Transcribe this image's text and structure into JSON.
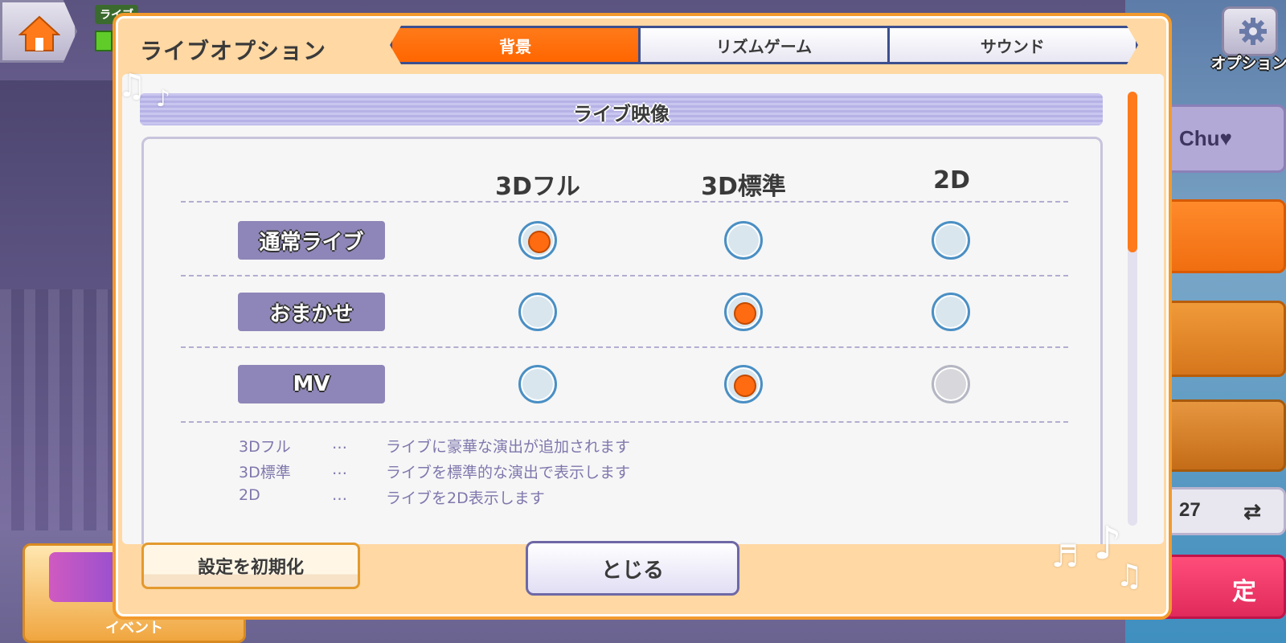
{
  "hud": {
    "live_tag": "ライブ",
    "option_label": "オプション",
    "side_chu": "Chu♥",
    "side_count": "27",
    "side_pink_text": "定",
    "event_label": "イベント"
  },
  "dialog": {
    "title": "ライブオプション",
    "tabs": [
      {
        "label": "背景",
        "active": true
      },
      {
        "label": "リズムゲーム",
        "active": false
      },
      {
        "label": "サウンド",
        "active": false
      }
    ],
    "section_title": "ライブ映像",
    "columns": [
      "3Dフル",
      "3D標準",
      "2D"
    ],
    "rows": [
      {
        "label": "通常ライブ",
        "selected": 0,
        "disabled": []
      },
      {
        "label": "おまかせ",
        "selected": 1,
        "disabled": []
      },
      {
        "label": "MV",
        "selected": 1,
        "disabled": [
          2
        ]
      }
    ],
    "descriptions": [
      {
        "term": "3Dフル",
        "sep": "…",
        "text": "ライブに豪華な演出が追加されます"
      },
      {
        "term": "3D標準",
        "sep": "…",
        "text": "ライブを標準的な演出で表示します"
      },
      {
        "term": "2D",
        "sep": "…",
        "text": "ライブを2D表示します"
      }
    ],
    "reset_label": "設定を初期化",
    "close_label": "とじる"
  },
  "colors": {
    "accent_orange": "#ff6600",
    "tab_border": "#3c4f8e",
    "row_label_bg": "#8e86b8",
    "dialog_frame": "#f29a2e",
    "radio_ring": "#4a8fc4"
  },
  "scroll": {
    "position_fraction": 0.0,
    "visible_fraction": 0.37
  }
}
